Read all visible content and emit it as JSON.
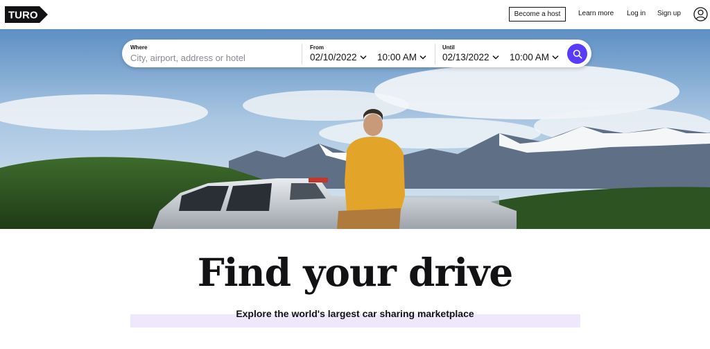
{
  "header": {
    "logo_text": "TURO",
    "become_host": "Become a host",
    "learn_more": "Learn more",
    "log_in": "Log in",
    "sign_up": "Sign up"
  },
  "search": {
    "where_label": "Where",
    "where_placeholder": "City, airport, address or hotel",
    "from_label": "From",
    "from_date": "02/10/2022",
    "from_time": "10:00 AM",
    "until_label": "Until",
    "until_date": "02/13/2022",
    "until_time": "10:00 AM"
  },
  "hero": {
    "headline": "Find your drive",
    "subheadline": "Explore the world's largest car sharing marketplace"
  },
  "colors": {
    "brand": "#121214",
    "accent": "#593cfb",
    "highlight": "#efe8fd"
  },
  "icons": [
    "turo-logo",
    "chevron-down-icon",
    "search-icon",
    "user-account-icon"
  ]
}
